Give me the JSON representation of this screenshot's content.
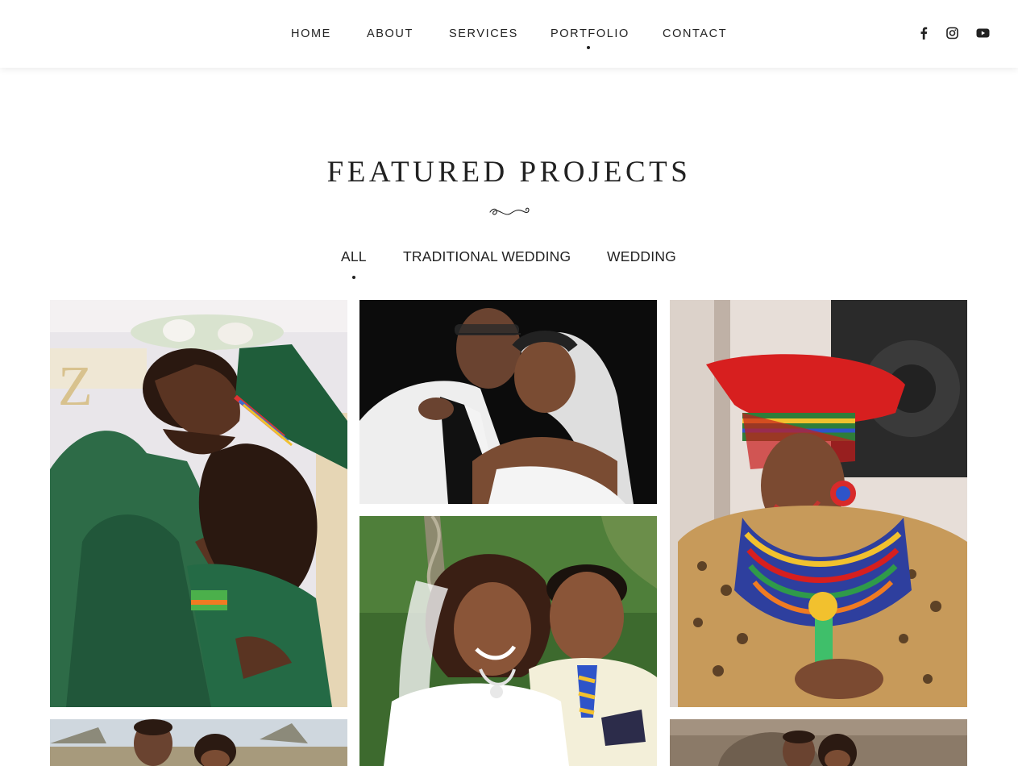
{
  "nav": {
    "items": [
      "HOME",
      "ABOUT",
      "SERVICES",
      "PORTFOLIO",
      "CONTACT"
    ],
    "active": "PORTFOLIO"
  },
  "social": [
    "facebook-icon",
    "instagram-icon",
    "youtube-icon"
  ],
  "section": {
    "title": "FEATURED PROJECTS"
  },
  "filters": {
    "items": [
      "ALL",
      "TRADITIONAL WEDDING",
      "WEDDING"
    ],
    "active": "ALL"
  },
  "portfolio": {
    "items": [
      "couple-green-traditional-photo",
      "couple-white-suit-veil-photo",
      "woman-red-hat-beaded-photo",
      "couple-cream-suit-garden-photo",
      "couple-outdoor-field-photo",
      "couple-stone-wall-photo"
    ]
  },
  "colors": {
    "text": "#222222",
    "background": "#ffffff"
  }
}
